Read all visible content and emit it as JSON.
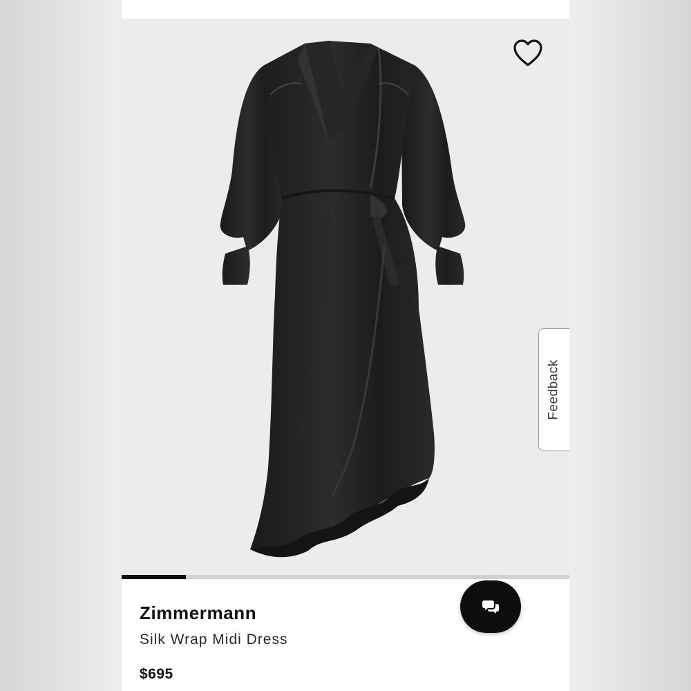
{
  "product": {
    "brand": "Zimmermann",
    "name": "Silk Wrap Midi Dress",
    "price": "$695"
  },
  "gallery": {
    "image_subject": "black silk wrap midi dress",
    "progress_fraction": 0.143
  },
  "feedback": {
    "label": "Feedback"
  },
  "icons": {
    "favorite": "heart-outline-icon",
    "chat": "chat-bubbles-icon"
  },
  "colors": {
    "accent": "#111111",
    "gallery_background": "#ececec",
    "progress_track": "#d2d2d2",
    "dress": "#1f1f1f"
  }
}
